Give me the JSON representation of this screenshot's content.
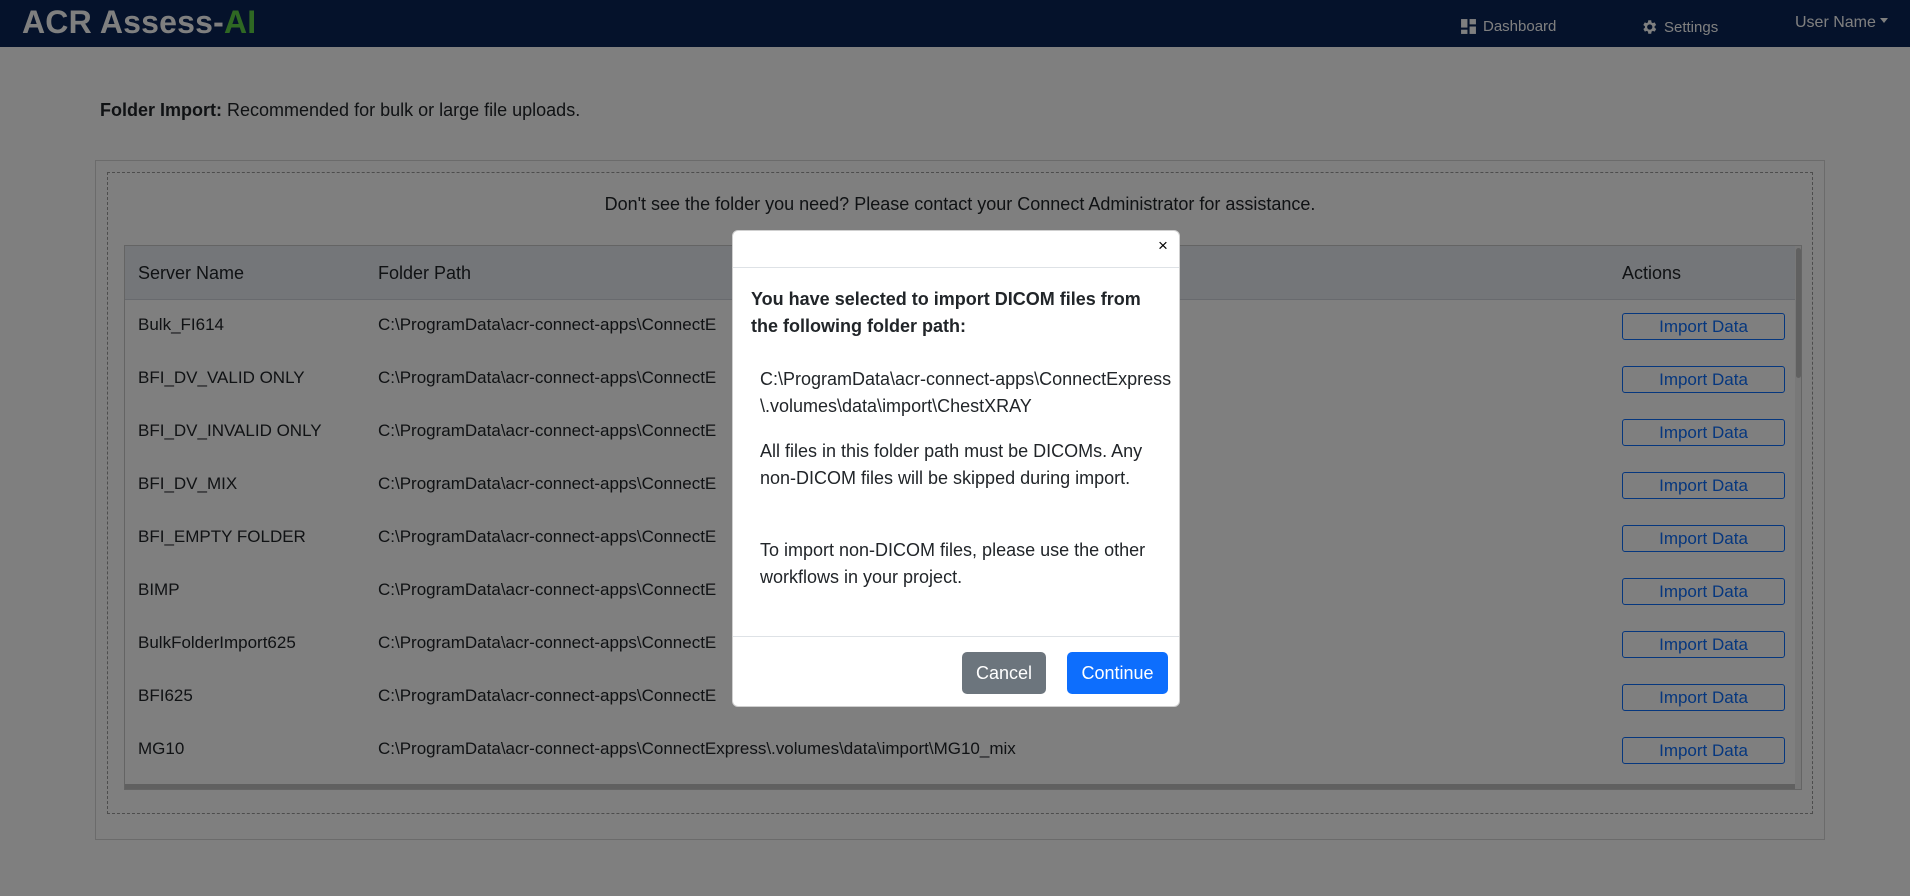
{
  "header": {
    "brand_main": "ACR Assess-",
    "brand_accent": "AI",
    "dashboard_label": "Dashboard",
    "settings_label": "Settings",
    "user_label": "User Name"
  },
  "page": {
    "folder_import_label": "Folder Import:",
    "folder_import_desc": " Recommended for bulk or large file uploads.",
    "help_text": "Don't see the folder you need? Please contact your Connect Administrator for assistance."
  },
  "table": {
    "columns": [
      "Server Name",
      "Folder Path",
      "Actions"
    ],
    "action_label": "Import Data",
    "rows": [
      {
        "server": "Bulk_FI614",
        "path": "C:\\ProgramData\\acr-connect-apps\\ConnectE"
      },
      {
        "server": "BFI_DV_VALID ONLY",
        "path": "C:\\ProgramData\\acr-connect-apps\\ConnectE"
      },
      {
        "server": "BFI_DV_INVALID ONLY",
        "path": "C:\\ProgramData\\acr-connect-apps\\ConnectE"
      },
      {
        "server": "BFI_DV_MIX",
        "path": "C:\\ProgramData\\acr-connect-apps\\ConnectE"
      },
      {
        "server": "BFI_EMPTY FOLDER",
        "path": "C:\\ProgramData\\acr-connect-apps\\ConnectE"
      },
      {
        "server": "BIMP",
        "path": "C:\\ProgramData\\acr-connect-apps\\ConnectE"
      },
      {
        "server": "BulkFolderImport625",
        "path": "C:\\ProgramData\\acr-connect-apps\\ConnectE"
      },
      {
        "server": "BFI625",
        "path": "C:\\ProgramData\\acr-connect-apps\\ConnectE"
      },
      {
        "server": "MG10",
        "path": "C:\\ProgramData\\acr-connect-apps\\ConnectExpress\\.volumes\\data\\import\\MG10_mix"
      }
    ]
  },
  "modal": {
    "close_label": "×",
    "title": "You have selected to import DICOM files from the following folder path:",
    "path": "C:\\ProgramData\\acr-connect-apps\\ConnectExpress\\.volumes\\data\\import\\ChestXRAY",
    "note1": "All files in this folder path must be DICOMs. Any non-DICOM files will be skipped during import.",
    "note2": "To import non-DICOM files, please use the other workflows in your project.",
    "cancel_label": "Cancel",
    "continue_label": "Continue"
  },
  "colors": {
    "navbar": "#0a2457",
    "brand_accent": "#5fd047",
    "primary": "#0d6efd",
    "secondary": "#6c757d"
  }
}
